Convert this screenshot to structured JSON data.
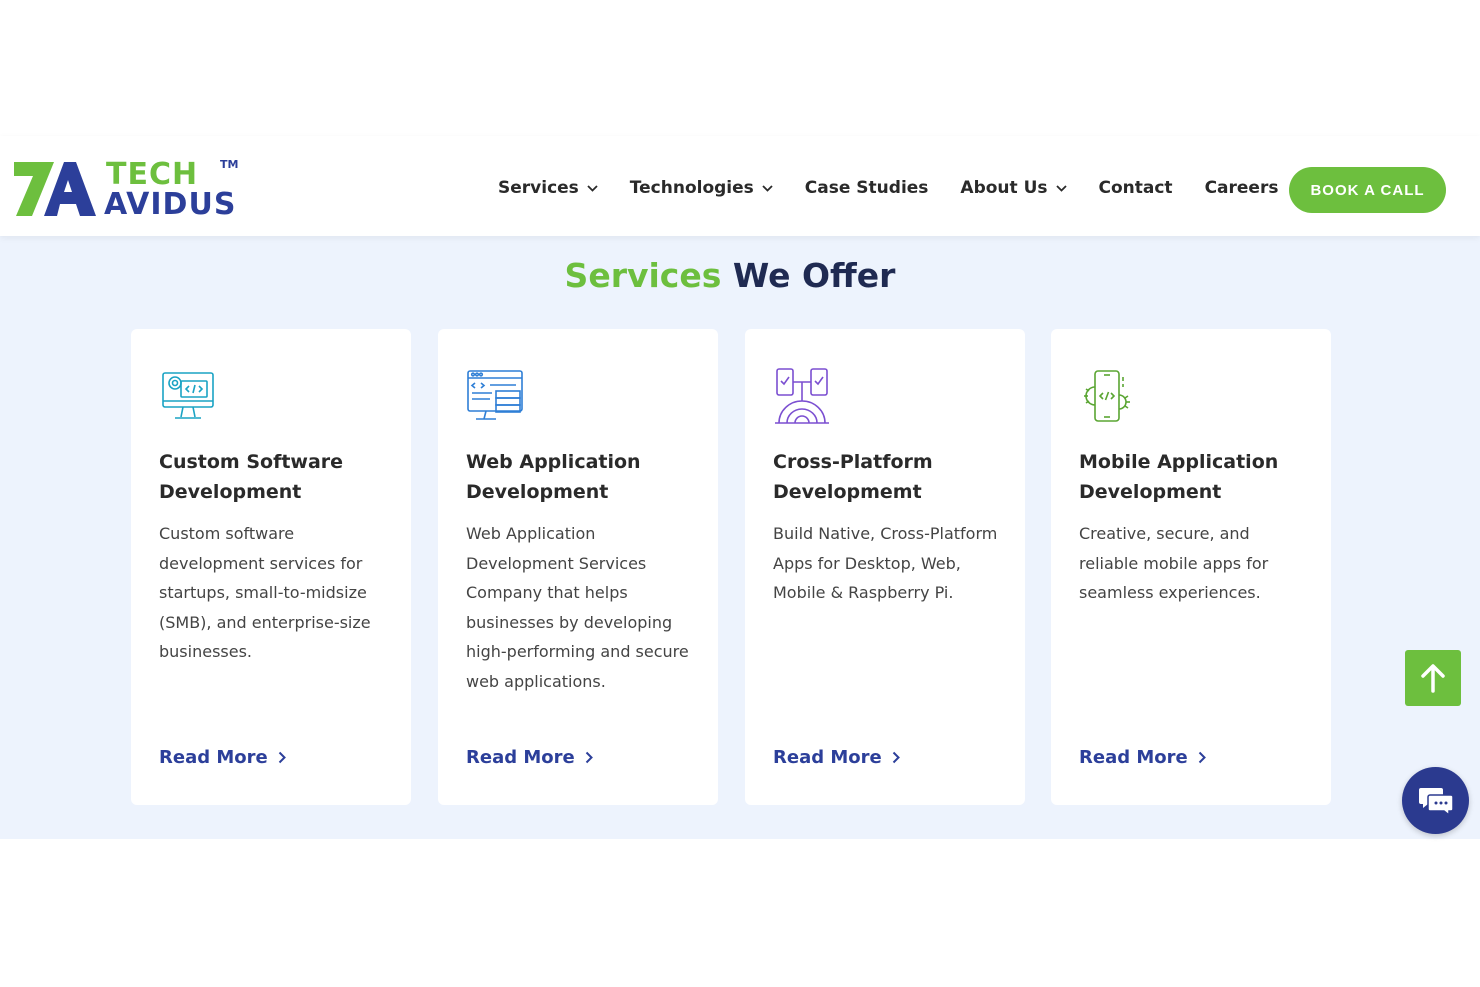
{
  "brand": {
    "name_line1": "TECH",
    "name_line2": "AVIDUS",
    "trademark": "TM",
    "colors": {
      "green": "#6dbf3e",
      "blue": "#2c3f9a"
    }
  },
  "nav": {
    "items": [
      {
        "label": "Services",
        "has_dropdown": true
      },
      {
        "label": "Technologies",
        "has_dropdown": true
      },
      {
        "label": "Case Studies",
        "has_dropdown": false
      },
      {
        "label": "About Us",
        "has_dropdown": true
      },
      {
        "label": "Contact",
        "has_dropdown": false
      },
      {
        "label": "Careers",
        "has_dropdown": false
      }
    ],
    "cta_label": "BOOK A CALL"
  },
  "section": {
    "title_accent": "Services",
    "title_rest": "We Offer",
    "cards": [
      {
        "icon": "monitor-code-gear-icon",
        "title": "Custom Software Development",
        "description": "Custom software development services for startups, small-to-midsize (SMB), and enterprise-size businesses.",
        "link_label": "Read More"
      },
      {
        "icon": "browser-server-icon",
        "title": "Web Application Development",
        "description": "Web Application Development Services Company that helps businesses by developing high-performing and secure web applications.",
        "link_label": "Read More"
      },
      {
        "icon": "cross-platform-devices-icon",
        "title": "Cross-Platform Developmemt",
        "description": "Build Native, Cross-Platform Apps for Desktop, Web, Mobile & Raspberry Pi.",
        "link_label": "Read More"
      },
      {
        "icon": "mobile-code-gear-icon",
        "title": "Mobile Application Development",
        "description": "Creative, secure, and reliable mobile apps for seamless experiences.",
        "link_label": "Read More"
      }
    ]
  },
  "floating": {
    "scroll_top_icon": "arrow-up-icon",
    "chat_icon": "chat-bubbles-icon"
  }
}
